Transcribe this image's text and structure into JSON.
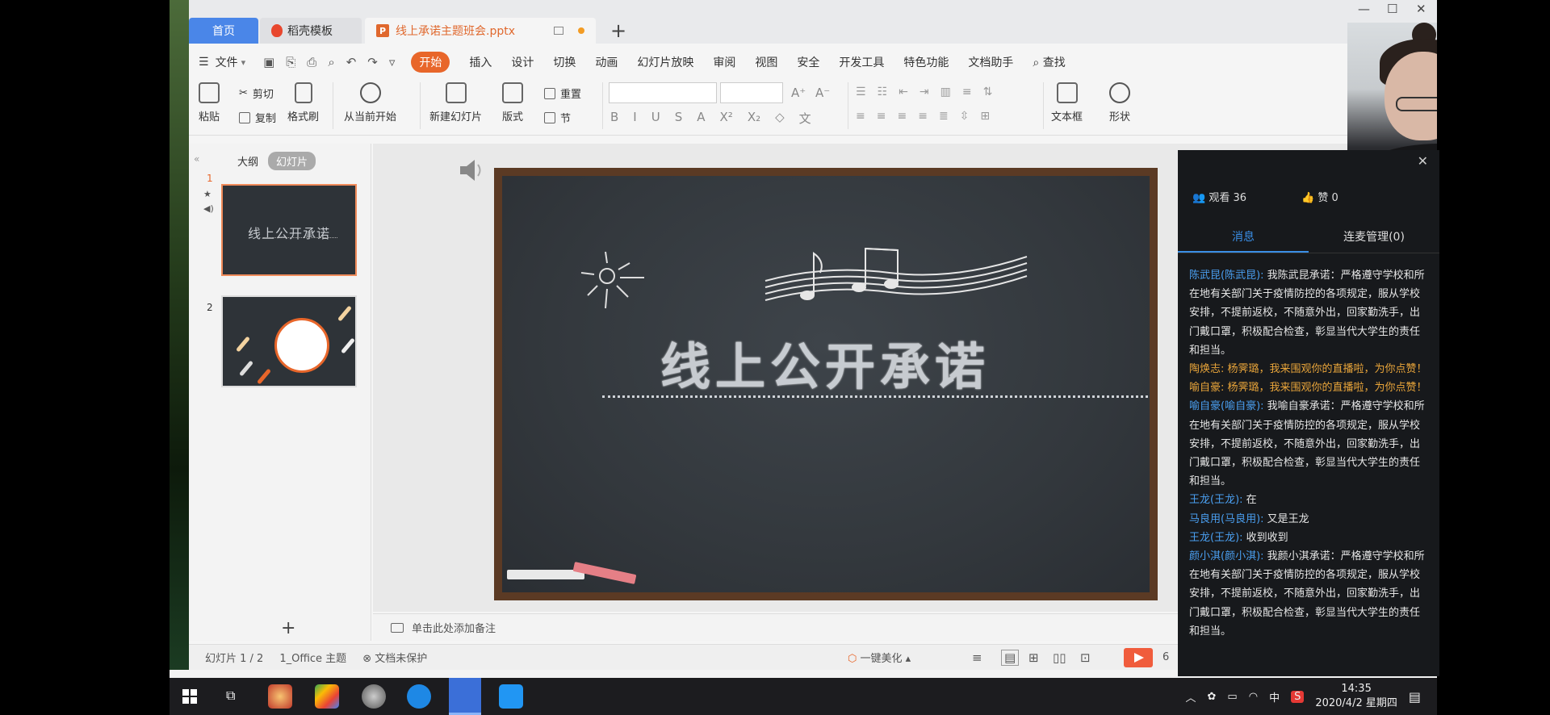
{
  "tabs": [
    {
      "label": "首页"
    },
    {
      "label": "稻壳模板"
    },
    {
      "label": "线上承诺主题班会.pptx"
    }
  ],
  "menu": {
    "file": "文件",
    "items": [
      "开始",
      "插入",
      "设计",
      "切换",
      "动画",
      "幻灯片放映",
      "审阅",
      "视图",
      "安全",
      "开发工具",
      "特色功能",
      "文档助手"
    ],
    "search": "查找"
  },
  "ribbon": {
    "paste": "粘贴",
    "cut": "剪切",
    "copy": "复制",
    "format_painter": "格式刷",
    "from_current": "从当前开始",
    "new_slide": "新建幻灯片",
    "layout": "版式",
    "reset": "重置",
    "section": "节",
    "textbox": "文本框",
    "shape": "形状"
  },
  "left_panel": {
    "outline_tab": "大纲",
    "slides_tab": "幻灯片",
    "slides": [
      {
        "number": "1",
        "title": "线上公开承诺"
      },
      {
        "number": "2"
      }
    ]
  },
  "slide": {
    "title": "线上公开承诺"
  },
  "notes_placeholder": "单击此处添加备注",
  "status": {
    "slide_counter": "幻灯片 1 / 2",
    "theme": "1_Office 主题",
    "protection": "文档未保护",
    "beautify": "一键美化",
    "zoom_partial": "6"
  },
  "live": {
    "viewers": "观看 36",
    "likes": "赞 0",
    "tab_messages": "消息",
    "tab_connect": "连麦管理(0)",
    "messages": [
      {
        "user": "陈武昆(陈武昆):",
        "text": " 我陈武昆承诺：严格遵守学校和所在地有关部门关于疫情防控的各项规定，服从学校安排，不提前返校，不随意外出，回家勤洗手，出门戴口罩，积极配合检查，彰显当代大学生的责任和担当。",
        "style": "normal"
      },
      {
        "user": "陶焕志:",
        "text": " 杨霁璐，我来围观你的直播啦，为你点赞！",
        "style": "orange"
      },
      {
        "user": "喻自豪:",
        "text": " 杨霁璐，我来围观你的直播啦，为你点赞！",
        "style": "orange"
      },
      {
        "user": "喻自豪(喻自豪):",
        "text": " 我喻自豪承诺：严格遵守学校和所在地有关部门关于疫情防控的各项规定，服从学校安排，不提前返校，不随意外出，回家勤洗手，出门戴口罩，积极配合检查，彰显当代大学生的责任和担当。",
        "style": "normal"
      },
      {
        "user": "王龙(王龙):",
        "text": " 在",
        "style": "normal"
      },
      {
        "user": "马良用(马良用):",
        "text": " 又是王龙",
        "style": "normal"
      },
      {
        "user": "王龙(王龙):",
        "text": " 收到收到",
        "style": "normal"
      },
      {
        "user": "颜小淇(颜小淇):",
        "text": " 我颜小淇承诺：严格遵守学校和所在地有关部门关于疫情防控的各项规定，服从学校安排，不提前返校，不随意外出，回家勤洗手，出门戴口罩，积极配合检查，彰显当代大学生的责任和担当。",
        "style": "normal"
      }
    ]
  },
  "taskbar": {
    "time": "14:35",
    "date": "2020/4/2 星期四",
    "ime": "中"
  },
  "colors": {
    "accent": "#e8662a",
    "home_tab": "#4a86e8",
    "chat_user": "#4a9ff0",
    "chat_orange": "#e9a53a",
    "chalkboard": "#33383d",
    "frame": "#5b3a24"
  }
}
